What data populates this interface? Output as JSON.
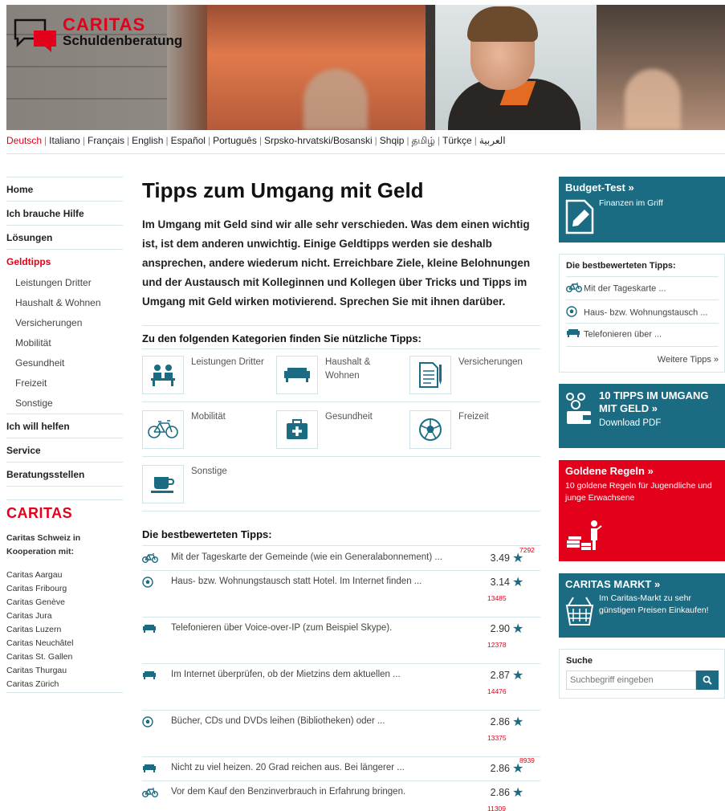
{
  "header": {
    "logo_title": "CARITAS",
    "logo_sub": "Schuldenberatung"
  },
  "languages": [
    "Deutsch",
    "Italiano",
    "Français",
    "English",
    "Español",
    "Português",
    "Srpsko-hrvatski/Bosanski",
    "Shqip",
    "தமிழ்",
    "Türkçe",
    "العربية"
  ],
  "active_language": "Deutsch",
  "nav": {
    "items": [
      {
        "label": "Home",
        "type": "main"
      },
      {
        "label": "Ich brauche Hilfe",
        "type": "main"
      },
      {
        "label": "Lösungen",
        "type": "main"
      },
      {
        "label": "Geldtipps",
        "type": "main",
        "active": true
      },
      {
        "label": "Leistungen Dritter",
        "type": "sub"
      },
      {
        "label": "Haushalt & Wohnen",
        "type": "sub"
      },
      {
        "label": "Versicherungen",
        "type": "sub"
      },
      {
        "label": "Mobilität",
        "type": "sub"
      },
      {
        "label": "Gesundheit",
        "type": "sub"
      },
      {
        "label": "Freizeit",
        "type": "sub"
      },
      {
        "label": "Sonstige",
        "type": "sub"
      },
      {
        "label": "Ich will helfen",
        "type": "main"
      },
      {
        "label": "Service",
        "type": "main"
      },
      {
        "label": "Beratungsstellen",
        "type": "main"
      }
    ]
  },
  "caritas": {
    "logo": "CARITAS",
    "coop_label": "Caritas Schweiz in Kooperation mit:",
    "orgs": [
      "Caritas Aargau",
      "Caritas Fribourg",
      "Caritas Genève",
      "Caritas Jura",
      "Caritas Luzern",
      "Caritas Neuchâtel",
      "Caritas St. Gallen",
      "Caritas Thurgau",
      "Caritas Zürich"
    ]
  },
  "main": {
    "title": "Tipps zum Umgang mit Geld",
    "intro": "Im Umgang mit Geld sind wir alle sehr verschieden. Was dem einen wichtig ist, ist dem anderen unwichtig. Einige Geldtipps werden sie deshalb ansprechen, andere wiederum nicht. Erreichbare Ziele, kleine Belohnungen und der Austausch mit Kolleginnen und Kollegen über Tricks und Tipps im Umgang mit Geld wirken motivierend. Sprechen Sie mit ihnen darüber.",
    "categories_heading": "Zu den folgenden Kategorien finden Sie nützliche Tipps:",
    "categories": [
      {
        "label": "Leistungen Dritter",
        "icon": "people-icon"
      },
      {
        "label": "Haushalt & Wohnen",
        "icon": "sofa-icon"
      },
      {
        "label": "Versicherungen",
        "icon": "document-icon"
      },
      {
        "label": "Mobilität",
        "icon": "bicycle-icon"
      },
      {
        "label": "Gesundheit",
        "icon": "first-aid-icon"
      },
      {
        "label": "Freizeit",
        "icon": "soccer-ball-icon"
      },
      {
        "label": "Sonstige",
        "icon": "coffee-cup-icon"
      }
    ],
    "best_heading": "Die bestbewerteten Tipps:",
    "tips": [
      {
        "text": "Mit der Tageskarte der Gemeinde (wie ein Generalabonnement) ...",
        "rating": "3.49",
        "votes": "7292",
        "icon": "bicycle-icon"
      },
      {
        "text": "Haus- bzw. Wohnungstausch statt Hotel. Im Internet finden ...",
        "rating": "3.14",
        "votes": "13485",
        "icon": "soccer-ball-icon"
      },
      {
        "text": "Telefonieren über Voice-over-IP (zum Beispiel Skype).",
        "rating": "2.90",
        "votes": "12378",
        "icon": "sofa-icon"
      },
      {
        "text": "Im Internet überprüfen, ob der Mietzins dem aktuellen ...",
        "rating": "2.87",
        "votes": "14476",
        "icon": "sofa-icon"
      },
      {
        "text": "Bücher, CDs und DVDs leihen (Bibliotheken) oder ...",
        "rating": "2.86",
        "votes": "13375",
        "icon": "soccer-ball-icon"
      },
      {
        "text": "Nicht zu viel heizen. 20 Grad reichen aus. Bei längerer ...",
        "rating": "2.86",
        "votes": "8939",
        "icon": "sofa-icon"
      },
      {
        "text": "Vor dem Kauf den Benzinverbrauch in Erfahrung bringen.",
        "rating": "2.86",
        "votes": "11309",
        "icon": "bicycle-icon"
      }
    ]
  },
  "sidebar": {
    "budget": {
      "title": "Budget-Test »",
      "text": "Finanzen im Griff"
    },
    "best": {
      "title": "Die bestbewerteten Tipps:",
      "items": [
        {
          "text": "Mit der Tageskarte ...",
          "icon": "bicycle-icon"
        },
        {
          "text": "Haus- bzw. Wohnungstausch ...",
          "icon": "soccer-ball-icon"
        },
        {
          "text": "Telefonieren über ...",
          "icon": "sofa-icon"
        }
      ],
      "more": "Weitere Tipps »"
    },
    "pdf": {
      "title": "10 TIPPS IM UMGANG MIT GELD »",
      "text": "Download PDF"
    },
    "rules": {
      "title": "Goldene Regeln »",
      "text": "10 goldene Regeln für Jugendliche und junge Erwachsene"
    },
    "markt": {
      "title": "CARITAS MARKT »",
      "text": "Im Caritas-Markt zu sehr günstigen Preisen Einkaufen!"
    },
    "search": {
      "title": "Suche",
      "placeholder": "Suchbegriff eingeben"
    }
  },
  "colors": {
    "accent_red": "#e2001a",
    "teal": "#1b6b82",
    "rule": "#d5e7e9"
  }
}
